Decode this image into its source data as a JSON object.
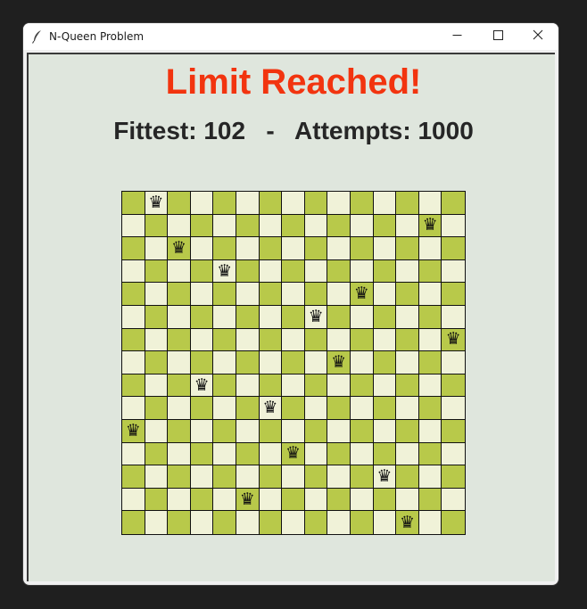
{
  "window": {
    "title": "N-Queen Problem",
    "icon": "feather-icon",
    "controls": [
      "minimize-icon",
      "maximize-icon",
      "close-icon"
    ]
  },
  "status": {
    "message": "Limit Reached!",
    "color": "#f2340f"
  },
  "stats": {
    "fittest_label": "Fittest:",
    "fittest_value": "102",
    "separator": "-",
    "attempts_label": "Attempts:",
    "attempts_value": "1000"
  },
  "board": {
    "size": 15,
    "dark_color": "#b8c94a",
    "light_color": "#f0f2d8",
    "queen_symbol": "♛",
    "queen_columns_by_row": [
      2,
      14,
      3,
      5,
      11,
      9,
      15,
      10,
      4,
      7,
      1,
      8,
      12,
      6,
      13
    ]
  }
}
